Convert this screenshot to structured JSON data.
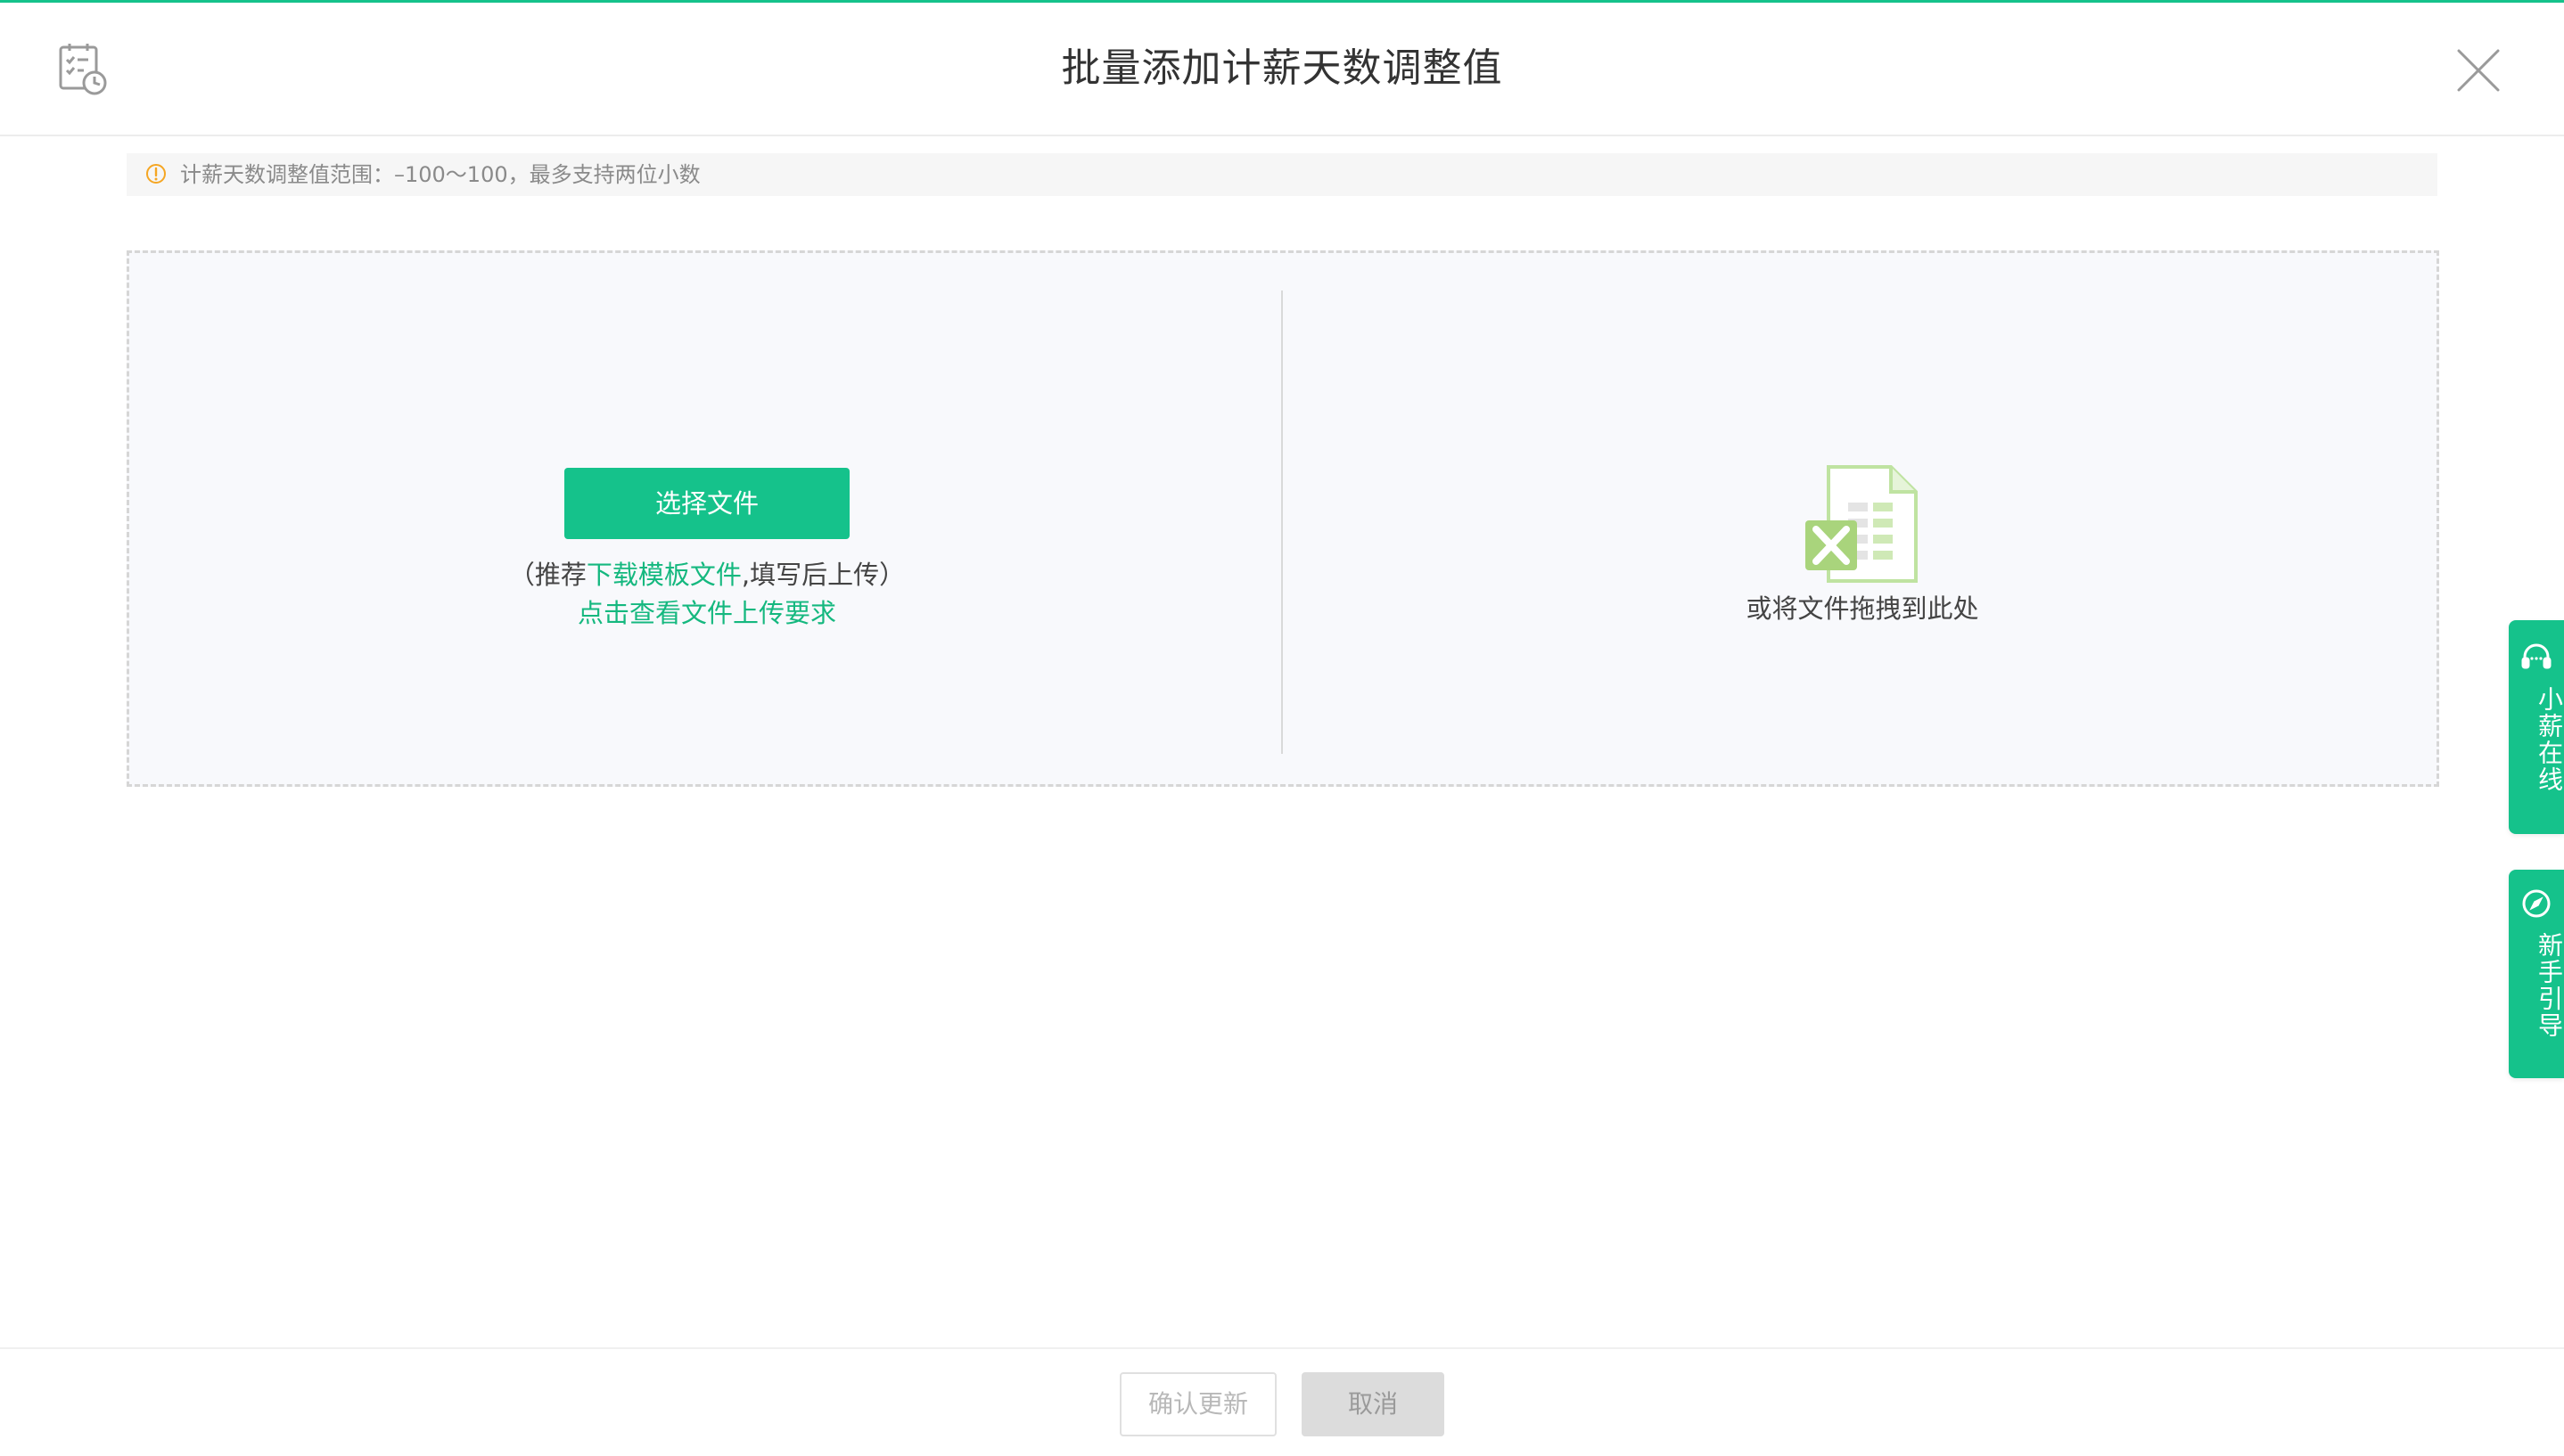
{
  "header": {
    "title": "批量添加计薪天数调整值",
    "app_icon": "calendar-check-clock-icon",
    "close_icon": "close-icon"
  },
  "notice": {
    "icon": "warning-circle-icon",
    "text": "计薪天数调整值范围：–100～100，最多支持两位小数"
  },
  "upload": {
    "select_button": "选择文件",
    "hint_prefix": "（推荐",
    "template_link": "下载模板文件",
    "hint_suffix": ",填写后上传）",
    "requirement_link": "点击查看文件上传要求",
    "file_icon": "excel-file-icon",
    "drag_text": "或将文件拖拽到此处"
  },
  "footer": {
    "confirm_label": "确认更新",
    "cancel_label": "取消"
  },
  "side_tabs": [
    {
      "label": "小薪在线",
      "icon": "headset-icon"
    },
    {
      "label": "新手引导",
      "icon": "compass-icon"
    }
  ],
  "colors": {
    "accent": "#15c28b",
    "warning": "#f5a623",
    "link": "#15b87f"
  }
}
